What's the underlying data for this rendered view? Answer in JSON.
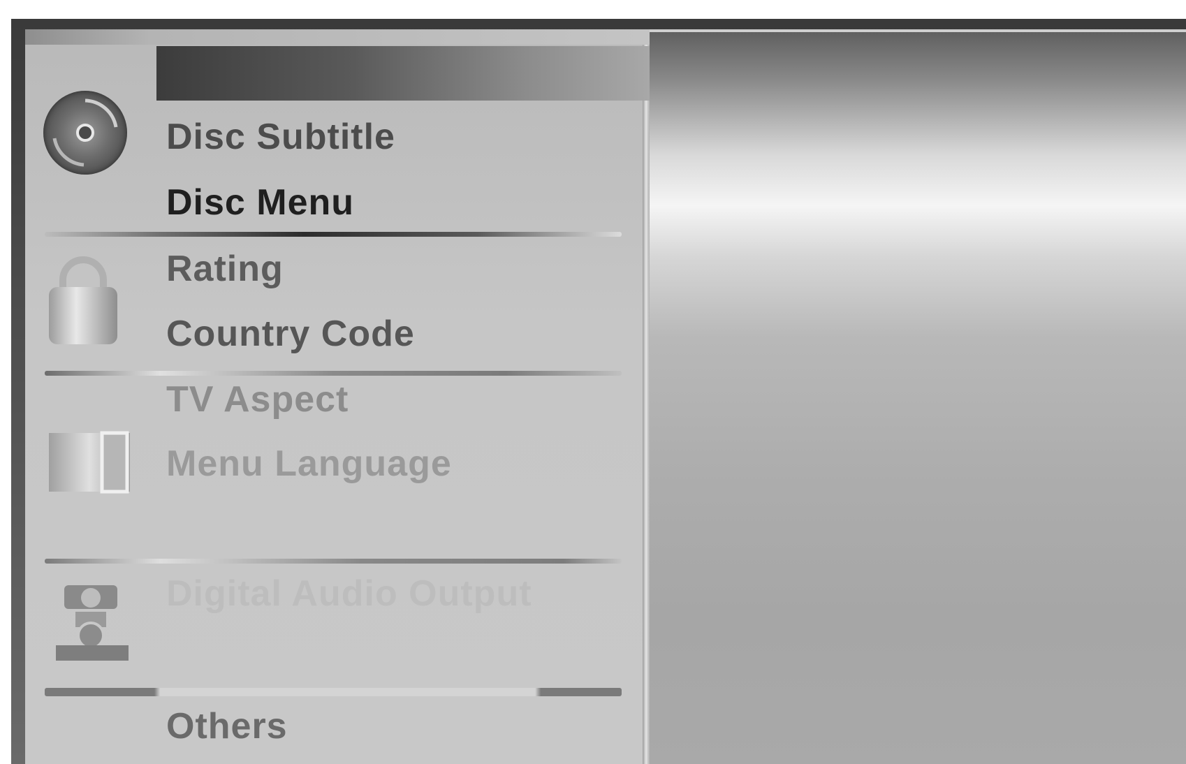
{
  "menu": {
    "items": [
      {
        "label": "Disc Subtitle",
        "icon": "disc-icon"
      },
      {
        "label": "Disc Menu",
        "icon": "disc-icon"
      },
      {
        "label": "Rating",
        "icon": "lock-icon"
      },
      {
        "label": "Country Code",
        "icon": "lock-icon"
      },
      {
        "label": "TV Aspect",
        "icon": "tv-screen-icon"
      },
      {
        "label": "Menu Language",
        "icon": "tv-screen-icon"
      },
      {
        "label": "Digital Audio Output",
        "icon": "speaker-icon"
      },
      {
        "label": "Others",
        "icon": ""
      }
    ],
    "selected_label": "Disc Menu"
  },
  "colors": {
    "frame": "#3a3a3a",
    "menu_background": "#c4c4c4",
    "selected_text": "#1f1f1f",
    "chrome_highlight": "#f5f5f5"
  }
}
